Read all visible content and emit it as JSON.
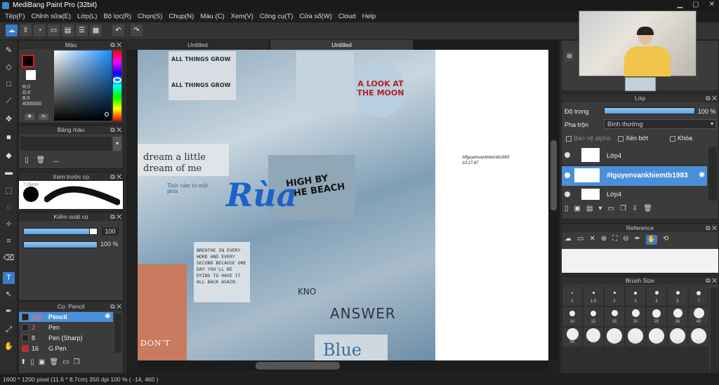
{
  "app": {
    "title": "MediBang Paint Pro (32bit)"
  },
  "menu": [
    "Tệp(F)",
    "Chỉnh sửa(E)",
    "Lớp(L)",
    "Bộ lọc(R)",
    "Chọn(S)",
    "Chụp(N)",
    "Màu (C)",
    "Xem(V)",
    "Công cụ(T)",
    "Cửa sổ(W)",
    "Cloud",
    "Help"
  ],
  "color_panel": {
    "title": "Màu",
    "r": "R:0",
    "g": "G:0",
    "b": "B:0",
    "hex": "#000000",
    "fg": "#e11919",
    "bg": "#ffffff"
  },
  "palette_panel": {
    "title": "Bảng màu",
    "none": "---"
  },
  "preview_panel": {
    "title": "Xem trước cọ",
    "size": "7.26mm"
  },
  "control_panel": {
    "title": "Kiểm soát cọ",
    "size_value": "100",
    "opacity_value": "100 %",
    "size_fraction": 0.9,
    "opacity_fraction": 1.0
  },
  "brush_list": {
    "title": "Cọ: Pencil",
    "items": [
      {
        "size": "100",
        "name": "Pencil",
        "color": "#222222",
        "active": true
      },
      {
        "size": "2",
        "name": "Pen",
        "color": "#222222",
        "active": false
      },
      {
        "size": "8",
        "name": "Pen (Sharp)",
        "color": "#222222",
        "active": false
      },
      {
        "size": "16",
        "name": "G Pen",
        "color": "#e02020",
        "active": false
      }
    ]
  },
  "tabs": [
    "Untitled",
    "Untitled"
  ],
  "canvas": {
    "note_line1": "#Ifguyenvankhiemtb1983",
    "note_line2": "10:17:47",
    "texts": {
      "all_things_grow": "ALL THINGS GROW",
      "all_things_grow2": "ALL THINGS GROW",
      "moon": "A LOOK AT THE MOON",
      "dream": "dream a little dream of me",
      "high": "HIGH BY THE BEACH",
      "rua": "Rùa",
      "breathe": "BREATHE IN EVERY WORD AND EVERY SECOND BECAUSE ONE DAY YOU'LL BE DYING TO HAVE IT ALL BACK AGAIN.",
      "answer": "ANSWER",
      "blue": "Blue",
      "dont": "DON'T",
      "kno": "KNO",
      "tinh_cam": "Tình cảm từ một phía"
    }
  },
  "layer_panel": {
    "title": "Lớp",
    "opacity_label": "Độ trong",
    "opacity_value": "100 %",
    "blend_label": "Pha trộn",
    "blend_value": "Bình thường",
    "protect_alpha": "Bảo vệ alpha",
    "clipping": "Xén bớt",
    "lock": "Khóa",
    "layers": [
      {
        "name": "Lớp4",
        "active": false
      },
      {
        "name": "#Iguyenvankhiemtb1983",
        "active": true
      },
      {
        "name": "Lớp4",
        "active": false
      }
    ]
  },
  "reference_panel": {
    "title": "Reference"
  },
  "brush_size_panel": {
    "title": "Brush Size",
    "sizes": [
      "1",
      "1.5",
      "2",
      "3",
      "4",
      "5",
      "7",
      "10",
      "12",
      "15",
      "20",
      "25",
      "30",
      "40",
      "50",
      "70",
      "100",
      "150",
      "200",
      "300",
      "400"
    ]
  },
  "status": {
    "text": "1600 * 1200 pixel  (11.6 * 8.7cm)  350 dpi  100 %  ( -14, 460 )"
  },
  "webcam": {
    "label": "webcam"
  }
}
